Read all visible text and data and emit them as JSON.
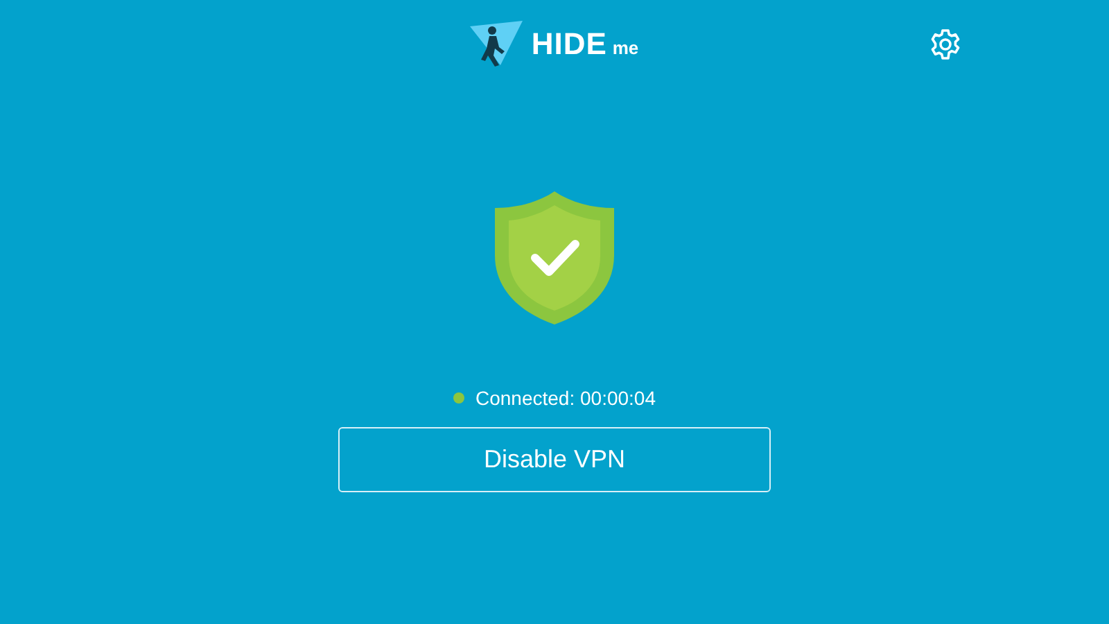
{
  "logo": {
    "word": "HIDE",
    "suffix": "me"
  },
  "status": {
    "connected": true,
    "text": "Connected: 00:00:04"
  },
  "button": {
    "label": "Disable VPN"
  }
}
